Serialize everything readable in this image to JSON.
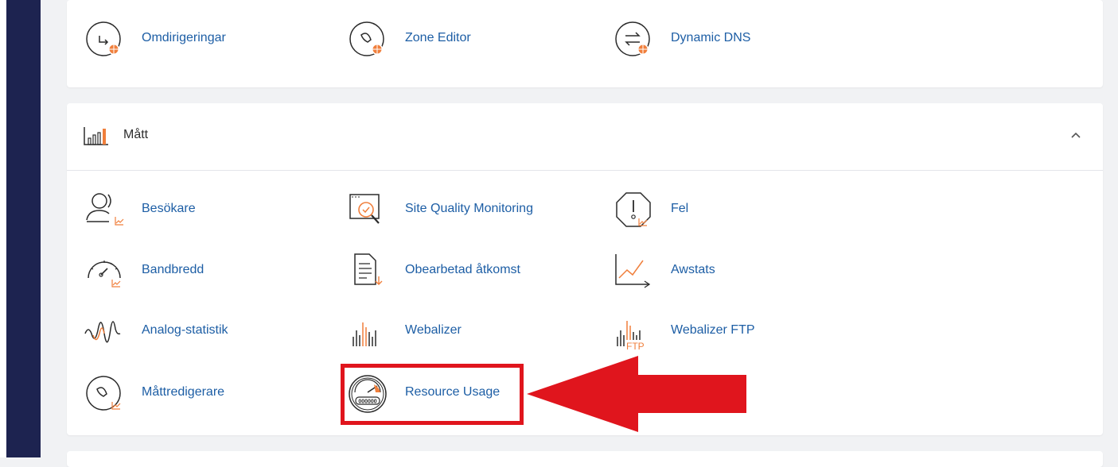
{
  "top_section": {
    "items": [
      {
        "label": "Omdirigeringar",
        "icon": "redirect-globe-icon"
      },
      {
        "label": "Zone Editor",
        "icon": "zone-editor-globe-icon"
      },
      {
        "label": "Dynamic DNS",
        "icon": "dynamic-dns-globe-icon"
      }
    ]
  },
  "metrics_section": {
    "title": "Mått",
    "icon": "bar-chart-icon",
    "collapse_icon": "chevron-up-icon",
    "items": [
      {
        "label": "Besökare",
        "icon": "visitors-icon"
      },
      {
        "label": "Site Quality Monitoring",
        "icon": "site-quality-icon"
      },
      {
        "label": "Fel",
        "icon": "error-octagon-icon"
      },
      {
        "label": "Bandbredd",
        "icon": "bandwidth-gauge-icon"
      },
      {
        "label": "Obearbetad åtkomst",
        "icon": "raw-access-icon"
      },
      {
        "label": "Awstats",
        "icon": "awstats-icon"
      },
      {
        "label": "Analog-statistik",
        "icon": "analog-stats-icon"
      },
      {
        "label": "Webalizer",
        "icon": "webalizer-icon"
      },
      {
        "label": "Webalizer FTP",
        "icon": "webalizer-ftp-icon"
      },
      {
        "label": "Måttredigerare",
        "icon": "metrics-editor-icon"
      },
      {
        "label": "Resource Usage",
        "icon": "resource-usage-icon"
      }
    ],
    "webalizer_ftp_badge": "FTP",
    "resource_usage_counter": "000000"
  },
  "annotation": {
    "highlight_color": "#e0151d",
    "pointer": "red-arrow-icon"
  },
  "colors": {
    "sidebar": "#1d2350",
    "link": "#1d5ea5",
    "accent": "#f07f3c"
  }
}
